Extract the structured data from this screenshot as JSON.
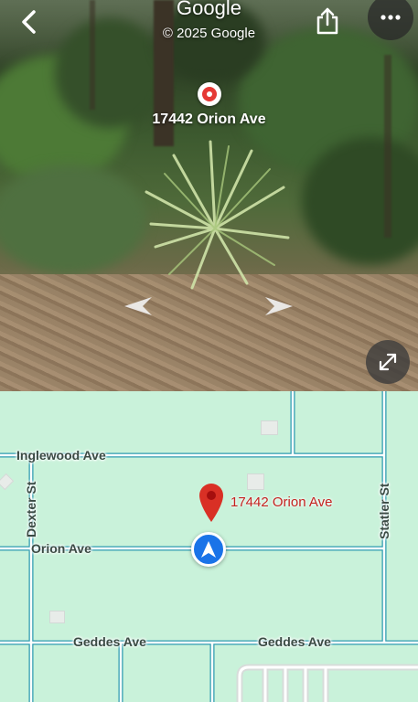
{
  "street_view": {
    "title": "Google",
    "copyright": "© 2025 Google",
    "place_label": "17442 Orion Ave",
    "icons": {
      "back": "chevron-left-icon",
      "share": "share-icon",
      "more": "more-horizontal-icon",
      "expand": "expand-icon",
      "nav_left": "chevron-left-icon",
      "nav_right": "chevron-right-icon",
      "place": "location-pin-icon"
    }
  },
  "map": {
    "place_label": "17442 Orion Ave",
    "streets": {
      "inglewood": "Inglewood Ave",
      "dexter": "Dexter St",
      "orion": "Orion Ave",
      "statler": "Statler St",
      "geddes_left": "Geddes Ave",
      "geddes_right": "Geddes Ave"
    },
    "colors": {
      "background": "#c9f2da",
      "road_outline": "#2d9bb0",
      "pin": "#d93025",
      "location": "#1a73e8"
    }
  }
}
